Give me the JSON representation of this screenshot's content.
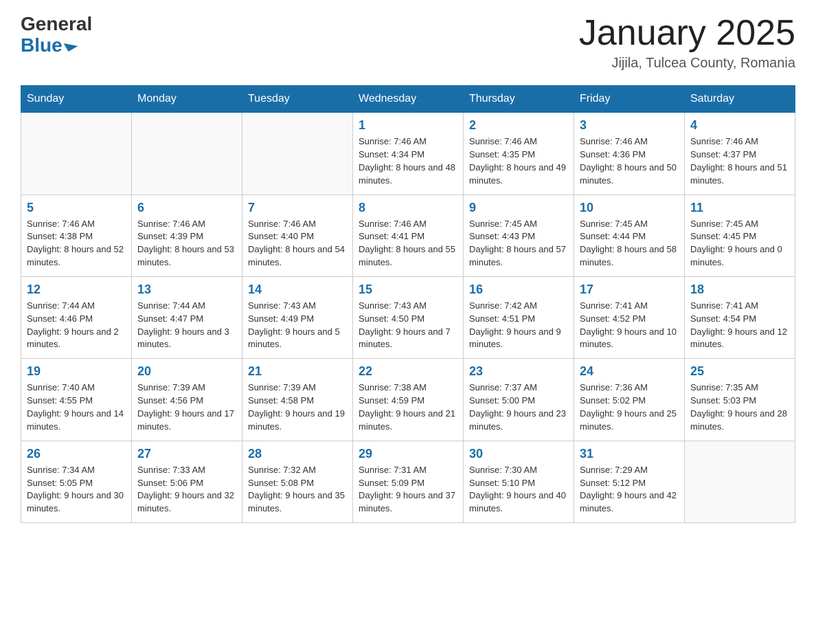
{
  "header": {
    "logo_general": "General",
    "logo_blue": "Blue",
    "month_title": "January 2025",
    "location": "Jijila, Tulcea County, Romania"
  },
  "days_of_week": [
    "Sunday",
    "Monday",
    "Tuesday",
    "Wednesday",
    "Thursday",
    "Friday",
    "Saturday"
  ],
  "weeks": [
    [
      {
        "day": "",
        "info": ""
      },
      {
        "day": "",
        "info": ""
      },
      {
        "day": "",
        "info": ""
      },
      {
        "day": "1",
        "info": "Sunrise: 7:46 AM\nSunset: 4:34 PM\nDaylight: 8 hours and 48 minutes."
      },
      {
        "day": "2",
        "info": "Sunrise: 7:46 AM\nSunset: 4:35 PM\nDaylight: 8 hours and 49 minutes."
      },
      {
        "day": "3",
        "info": "Sunrise: 7:46 AM\nSunset: 4:36 PM\nDaylight: 8 hours and 50 minutes."
      },
      {
        "day": "4",
        "info": "Sunrise: 7:46 AM\nSunset: 4:37 PM\nDaylight: 8 hours and 51 minutes."
      }
    ],
    [
      {
        "day": "5",
        "info": "Sunrise: 7:46 AM\nSunset: 4:38 PM\nDaylight: 8 hours and 52 minutes."
      },
      {
        "day": "6",
        "info": "Sunrise: 7:46 AM\nSunset: 4:39 PM\nDaylight: 8 hours and 53 minutes."
      },
      {
        "day": "7",
        "info": "Sunrise: 7:46 AM\nSunset: 4:40 PM\nDaylight: 8 hours and 54 minutes."
      },
      {
        "day": "8",
        "info": "Sunrise: 7:46 AM\nSunset: 4:41 PM\nDaylight: 8 hours and 55 minutes."
      },
      {
        "day": "9",
        "info": "Sunrise: 7:45 AM\nSunset: 4:43 PM\nDaylight: 8 hours and 57 minutes."
      },
      {
        "day": "10",
        "info": "Sunrise: 7:45 AM\nSunset: 4:44 PM\nDaylight: 8 hours and 58 minutes."
      },
      {
        "day": "11",
        "info": "Sunrise: 7:45 AM\nSunset: 4:45 PM\nDaylight: 9 hours and 0 minutes."
      }
    ],
    [
      {
        "day": "12",
        "info": "Sunrise: 7:44 AM\nSunset: 4:46 PM\nDaylight: 9 hours and 2 minutes."
      },
      {
        "day": "13",
        "info": "Sunrise: 7:44 AM\nSunset: 4:47 PM\nDaylight: 9 hours and 3 minutes."
      },
      {
        "day": "14",
        "info": "Sunrise: 7:43 AM\nSunset: 4:49 PM\nDaylight: 9 hours and 5 minutes."
      },
      {
        "day": "15",
        "info": "Sunrise: 7:43 AM\nSunset: 4:50 PM\nDaylight: 9 hours and 7 minutes."
      },
      {
        "day": "16",
        "info": "Sunrise: 7:42 AM\nSunset: 4:51 PM\nDaylight: 9 hours and 9 minutes."
      },
      {
        "day": "17",
        "info": "Sunrise: 7:41 AM\nSunset: 4:52 PM\nDaylight: 9 hours and 10 minutes."
      },
      {
        "day": "18",
        "info": "Sunrise: 7:41 AM\nSunset: 4:54 PM\nDaylight: 9 hours and 12 minutes."
      }
    ],
    [
      {
        "day": "19",
        "info": "Sunrise: 7:40 AM\nSunset: 4:55 PM\nDaylight: 9 hours and 14 minutes."
      },
      {
        "day": "20",
        "info": "Sunrise: 7:39 AM\nSunset: 4:56 PM\nDaylight: 9 hours and 17 minutes."
      },
      {
        "day": "21",
        "info": "Sunrise: 7:39 AM\nSunset: 4:58 PM\nDaylight: 9 hours and 19 minutes."
      },
      {
        "day": "22",
        "info": "Sunrise: 7:38 AM\nSunset: 4:59 PM\nDaylight: 9 hours and 21 minutes."
      },
      {
        "day": "23",
        "info": "Sunrise: 7:37 AM\nSunset: 5:00 PM\nDaylight: 9 hours and 23 minutes."
      },
      {
        "day": "24",
        "info": "Sunrise: 7:36 AM\nSunset: 5:02 PM\nDaylight: 9 hours and 25 minutes."
      },
      {
        "day": "25",
        "info": "Sunrise: 7:35 AM\nSunset: 5:03 PM\nDaylight: 9 hours and 28 minutes."
      }
    ],
    [
      {
        "day": "26",
        "info": "Sunrise: 7:34 AM\nSunset: 5:05 PM\nDaylight: 9 hours and 30 minutes."
      },
      {
        "day": "27",
        "info": "Sunrise: 7:33 AM\nSunset: 5:06 PM\nDaylight: 9 hours and 32 minutes."
      },
      {
        "day": "28",
        "info": "Sunrise: 7:32 AM\nSunset: 5:08 PM\nDaylight: 9 hours and 35 minutes."
      },
      {
        "day": "29",
        "info": "Sunrise: 7:31 AM\nSunset: 5:09 PM\nDaylight: 9 hours and 37 minutes."
      },
      {
        "day": "30",
        "info": "Sunrise: 7:30 AM\nSunset: 5:10 PM\nDaylight: 9 hours and 40 minutes."
      },
      {
        "day": "31",
        "info": "Sunrise: 7:29 AM\nSunset: 5:12 PM\nDaylight: 9 hours and 42 minutes."
      },
      {
        "day": "",
        "info": ""
      }
    ]
  ]
}
